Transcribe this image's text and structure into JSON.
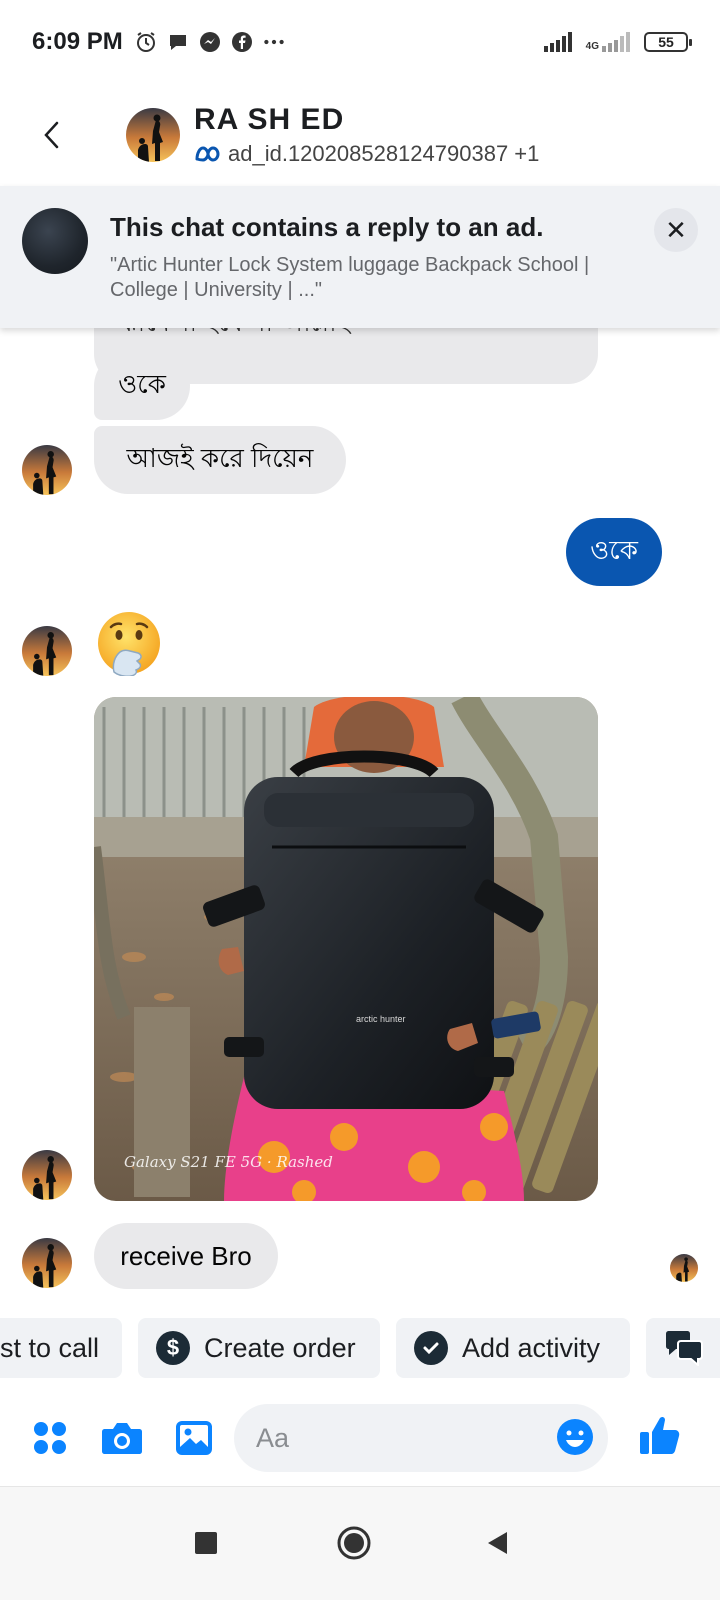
{
  "status_bar": {
    "time": "6:09 PM",
    "network_label": "4G",
    "battery": "55",
    "icons": [
      "alarm-icon",
      "chat-bubble-icon",
      "messenger-icon",
      "facebook-icon",
      "more-dots-icon"
    ]
  },
  "header": {
    "name": "RA SH ED",
    "subtitle": "ad_id.120208528124790387 +1"
  },
  "ad_banner": {
    "title": "This chat contains a reply to an ad.",
    "description": "\"Artic Hunter Lock System luggage Backpack School | College | University | ...\""
  },
  "messages": [
    {
      "sender": "them",
      "text": "ঝামেলা হবে না আল্লাহ"
    },
    {
      "sender": "them",
      "text": "ওকে"
    },
    {
      "sender": "them",
      "text": "আজই করে দিয়েন"
    },
    {
      "sender": "me",
      "text": "ওকে"
    },
    {
      "sender": "them",
      "text": "🫢"
    },
    {
      "sender": "them",
      "type": "photo",
      "caption": "Galaxy S21 FE 5G · Rashed",
      "brand_label": "arctic hunter"
    },
    {
      "sender": "them",
      "text": "receive Bro"
    }
  ],
  "quick_actions": [
    {
      "label": "st to call",
      "icon": "phone-icon"
    },
    {
      "label": "Create order",
      "icon": "dollar-icon"
    },
    {
      "label": "Add activity",
      "icon": "check-icon"
    },
    {
      "label": "",
      "icon": "chat-bubbles-icon"
    }
  ],
  "composer": {
    "placeholder": "Aa"
  },
  "colors": {
    "accent": "#0a56b0",
    "icon_blue": "#0b84ff",
    "incoming_bubble": "#e9e9eb",
    "banner_bg": "#f0f2f5"
  }
}
